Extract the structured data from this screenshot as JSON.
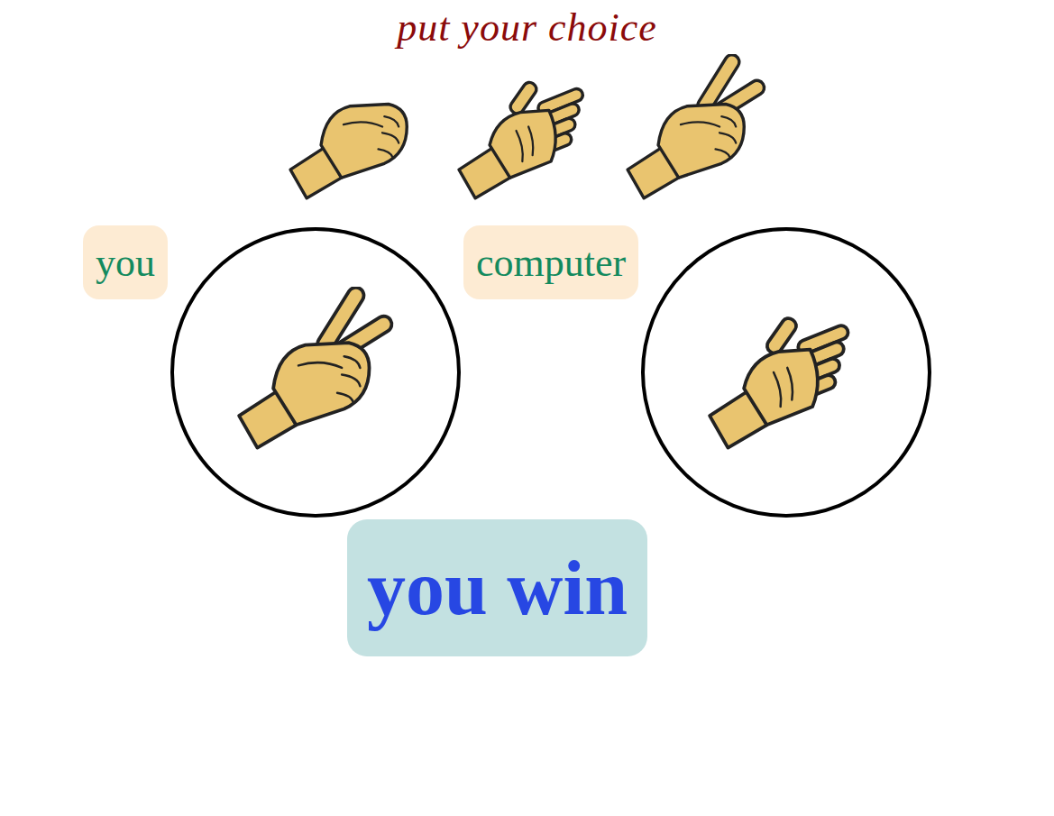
{
  "title": "put your choice",
  "choices": [
    {
      "kind": "rock"
    },
    {
      "kind": "paper"
    },
    {
      "kind": "scissors"
    }
  ],
  "players": [
    {
      "label": "you",
      "pick": {
        "kind": "scissors"
      }
    },
    {
      "label": "computer",
      "pick": {
        "kind": "paper"
      }
    }
  ],
  "result": "you win"
}
